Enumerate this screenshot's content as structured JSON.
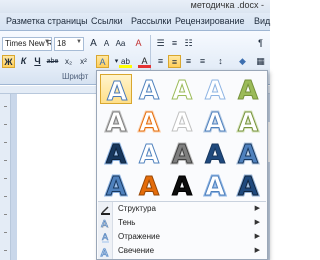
{
  "window": {
    "title": "методичка .docx -"
  },
  "ribbon_tabs": [
    "Разметка страницы",
    "Ссылки",
    "Рассылки",
    "Рецензирование",
    "Вид"
  ],
  "font": {
    "name": "Times New Rc",
    "size": "18"
  },
  "toolbar": {
    "bold": "Ж",
    "italic": "К",
    "underline": "Ч",
    "strike": "abe",
    "subscript": "x₂",
    "superscript": "x²",
    "grow": "A",
    "shrink": "A",
    "case": "Aa",
    "clear": "A",
    "effects": "A",
    "highlight": "ab",
    "color": "A",
    "group_label": "Шрифт"
  },
  "text_effects": {
    "rows": [
      [
        {
          "fill": "#ffffff",
          "stroke": "#4a7ab8",
          "glow": ""
        },
        {
          "fill": "#ffffff",
          "stroke": "#4f81bd",
          "glow": ""
        },
        {
          "fill": "#ffffff",
          "stroke": "#9bbb59",
          "glow": ""
        },
        {
          "fill": "#ffffff",
          "stroke": "#8eb4e3",
          "glow": ""
        },
        {
          "fill": "#9bbb59",
          "stroke": "#76923c",
          "glow": ""
        }
      ],
      [
        {
          "fill": "#ffffff",
          "stroke": "#7f7f7f",
          "glow": "#bfbfbf"
        },
        {
          "fill": "#ffffff",
          "stroke": "#e46c0a",
          "glow": "#fbd4b4"
        },
        {
          "fill": "#ffffff",
          "stroke": "#c0c0c0",
          "glow": ""
        },
        {
          "fill": "#ffffff",
          "stroke": "#4f81bd",
          "glow": "#b8cce4"
        },
        {
          "fill": "#ffffff",
          "stroke": "#76923c",
          "glow": "#d7e4bd"
        }
      ],
      [
        {
          "fill": "#17375e",
          "stroke": "#0f243e",
          "glow": "#8eb4e3"
        },
        {
          "fill": "#ffffff",
          "stroke": "#4f81bd",
          "glow": ""
        },
        {
          "fill": "#7f7f7f",
          "stroke": "#404040",
          "glow": "#bfbfbf"
        },
        {
          "fill": "#1f497d",
          "stroke": "#17375e",
          "glow": ""
        },
        {
          "fill": "#4f81bd",
          "stroke": "#17375e",
          "glow": "#b8cce4"
        }
      ],
      [
        {
          "fill": "#4f81bd",
          "stroke": "#17375e",
          "glow": "#8eb4e3"
        },
        {
          "fill": "#e46c0a",
          "stroke": "#984807",
          "glow": ""
        },
        {
          "fill": "#0d0d0d",
          "stroke": "#000000",
          "glow": ""
        },
        {
          "fill": "#ffffff",
          "stroke": "#4f81bd",
          "glow": "#8eb4e3"
        },
        {
          "fill": "#1f497d",
          "stroke": "#0f243e",
          "glow": "#95b3d7"
        }
      ]
    ],
    "letter": "A",
    "menu": [
      {
        "label": "Структура",
        "icon": "outline-icon"
      },
      {
        "label": "Тень",
        "icon": "shadow-icon"
      },
      {
        "label": "Отражение",
        "icon": "reflection-icon"
      },
      {
        "label": "Свечение",
        "icon": "glow-icon"
      }
    ]
  }
}
